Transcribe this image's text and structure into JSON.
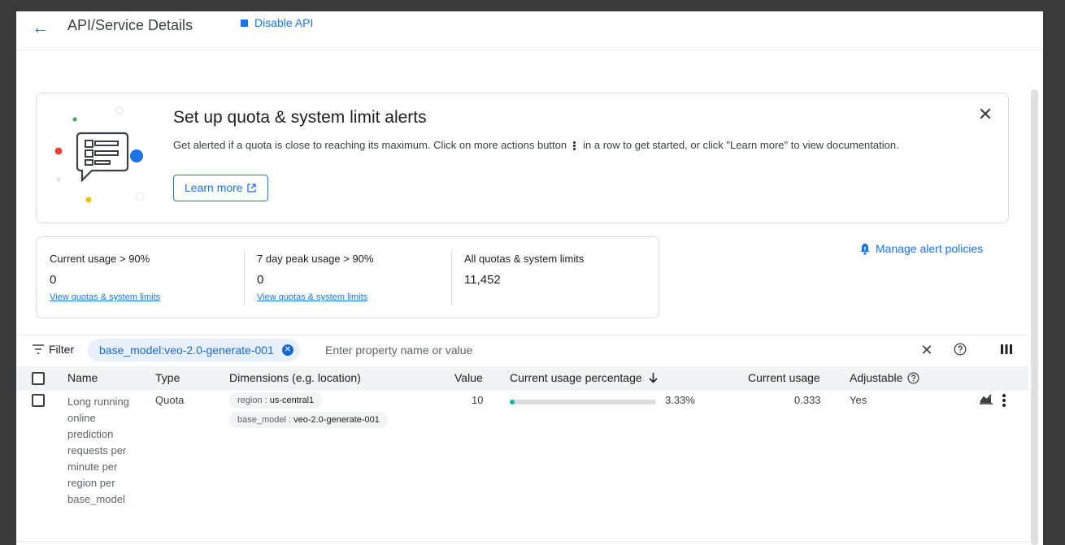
{
  "header": {
    "title": "API/Service Details",
    "disable_label": "Disable API"
  },
  "banner": {
    "title": "Set up quota & system limit alerts",
    "desc_before": "Get alerted if a quota is close to reaching its maximum. Click on more actions button",
    "desc_after": "in a row to get started, or click \"Learn more\" to view documentation.",
    "learn_more": "Learn more"
  },
  "stats": [
    {
      "label": "Current usage > 90%",
      "value": "0",
      "link": "View quotas & system limits"
    },
    {
      "label": "7 day peak usage > 90%",
      "value": "0",
      "link": "View quotas & system limits"
    },
    {
      "label": "All quotas & system limits",
      "value": "11,452"
    }
  ],
  "manage_alerts": "Manage alert policies",
  "filter": {
    "label": "Filter",
    "chip": "base_model:veo-2.0-generate-001",
    "placeholder": "Enter property name or value"
  },
  "table": {
    "columns": {
      "name": "Name",
      "type": "Type",
      "dimensions": "Dimensions (e.g. location)",
      "value": "Value",
      "usage_pct": "Current usage percentage",
      "usage": "Current usage",
      "adjustable": "Adjustable"
    },
    "rows": [
      {
        "name": "Long running online prediction requests per minute per region per base_model",
        "type": "Quota",
        "dim1_key": "region",
        "dim1_val": "us-central1",
        "dim2_key": "base_model",
        "dim2_val": "veo-2.0-generate-001",
        "value": "10",
        "usage_pct_label": "3.33%",
        "usage_pct": 0.0333,
        "usage": "0.333",
        "adjustable": "Yes"
      }
    ]
  },
  "colors": {
    "accent": "#1a73e8",
    "bar_fill": "#12b5a4",
    "chip_bg": "#e8f0fe"
  },
  "icons": [
    "back-arrow-icon",
    "stop-icon",
    "chat-illustration-icon",
    "close-icon",
    "external-link-icon",
    "more-vert-icon",
    "bell-icon",
    "filter-icon",
    "clear-icon",
    "help-icon",
    "columns-icon",
    "arrow-down-icon",
    "chart-icon"
  ]
}
